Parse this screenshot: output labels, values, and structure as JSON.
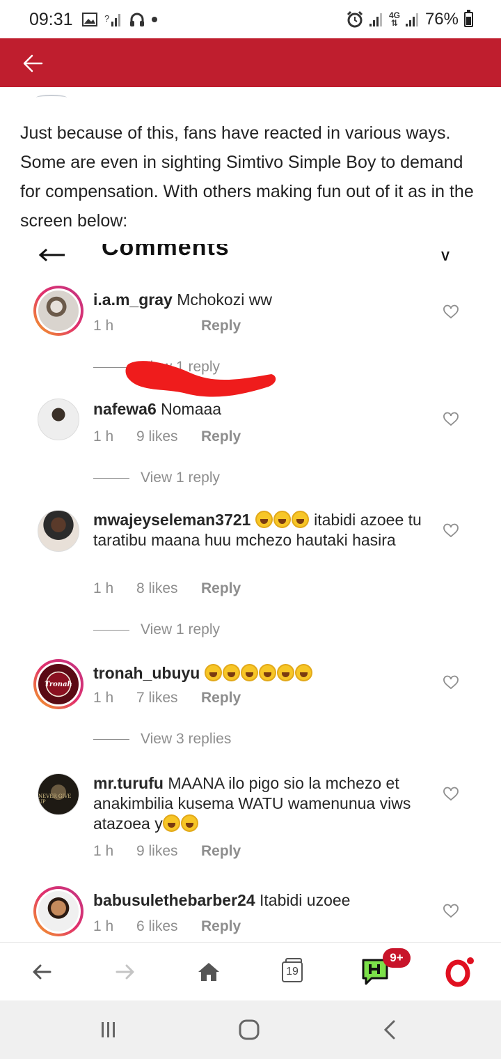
{
  "status_bar": {
    "time": "09:31",
    "network": "4G",
    "battery": "76%",
    "left_icons": [
      "image-icon",
      "wifi-question-icon",
      "headphones-icon",
      "dot-icon"
    ],
    "right_icons": [
      "alarm-icon",
      "signal-icon",
      "4g-icon",
      "signal-icon",
      "battery-icon"
    ]
  },
  "app_bar": {
    "color": "#bf1e2e",
    "back_icon": "arrow-left-icon"
  },
  "article": {
    "paragraph": "Just because of this, fans have reacted in various ways. Some are even in sighting Simtivo Simple Boy to demand for compensation. With others making fun out of it as in the screen below:"
  },
  "comments_screenshot": {
    "title": "Comments",
    "comments": [
      {
        "user": "i.a.m_gray",
        "text": "Mchokozi ww",
        "time": "1 h",
        "likes": "",
        "reply": "Reply",
        "view_replies": "View 1 reply"
      },
      {
        "user": "nafewa6",
        "text": "Nomaaa",
        "time": "1 h",
        "likes": "9 likes",
        "reply": "Reply",
        "view_replies": "View 1 reply"
      },
      {
        "user": "mwajeyseleman3721",
        "text_before": "",
        "text_after": "itabidi azoee tu taratibu maana huu mchezo hautaki hasira",
        "emoji_count": 3,
        "time": "1 h",
        "likes": "8 likes",
        "reply": "Reply",
        "view_replies": "View 1 reply"
      },
      {
        "user": "tronah_ubuyu",
        "emoji_count": 6,
        "time": "1 h",
        "likes": "7 likes",
        "reply": "Reply",
        "view_replies": "View 3 replies",
        "avatar_text": "Tronah"
      },
      {
        "user": "mr.turufu",
        "text": "MAANA ilo pigo sio la mchezo et anakimbilia kusema WATU wamenunua viws atazoea y",
        "emoji_count": 2,
        "time": "1 h",
        "likes": "9 likes",
        "reply": "Reply",
        "avatar_text": "NEVER GIVE UP"
      },
      {
        "user": "babusulethebarber24",
        "text": "Itabidi uzoee",
        "time": "1 h",
        "likes": "6 likes",
        "reply": "Reply"
      }
    ]
  },
  "browser_toolbar": {
    "tab_count": "19",
    "notification_badge": "9+",
    "icons": [
      "back-icon",
      "forward-icon",
      "home-icon",
      "tabs-icon",
      "news-icon",
      "opera-icon"
    ]
  },
  "nav_bar": {
    "icons": [
      "recents-icon",
      "home-circle-icon",
      "back-chevron-icon"
    ]
  }
}
